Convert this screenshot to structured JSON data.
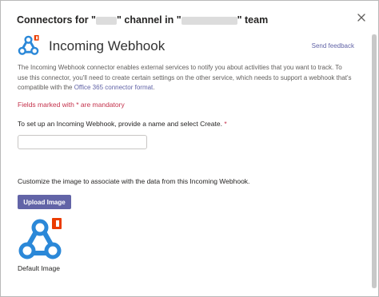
{
  "dialog": {
    "title_part1": "Connectors for \"",
    "title_part2": "\" channel in \"",
    "title_part3": "\" team"
  },
  "connector": {
    "name": "Incoming Webhook",
    "send_feedback": "Send feedback",
    "description": "The Incoming Webhook connector enables external services to notify you about activities that you want to track. To use this connector, you'll need to create certain settings on the other service, which needs to support a webhook that's compatible with the ",
    "description_link": "Office 365 connector format",
    "description_end": "."
  },
  "form": {
    "mandatory_note": "Fields marked with * are mandatory",
    "setup_instruction": "To set up an Incoming Webhook, provide a name and select Create.",
    "required_marker": "*",
    "name_value": "",
    "customize_instruction": "Customize the image to associate with the data from this Incoming Webhook.",
    "upload_button": "Upload Image",
    "default_image_label": "Default Image"
  },
  "icons": {
    "close": "close-icon",
    "logo": "webhook-icon",
    "badge": "office-icon"
  },
  "colors": {
    "accent": "#6264a7",
    "required": "#c4314b",
    "webhook_blue": "#2b88d8",
    "office_orange": "#eb3c00"
  }
}
